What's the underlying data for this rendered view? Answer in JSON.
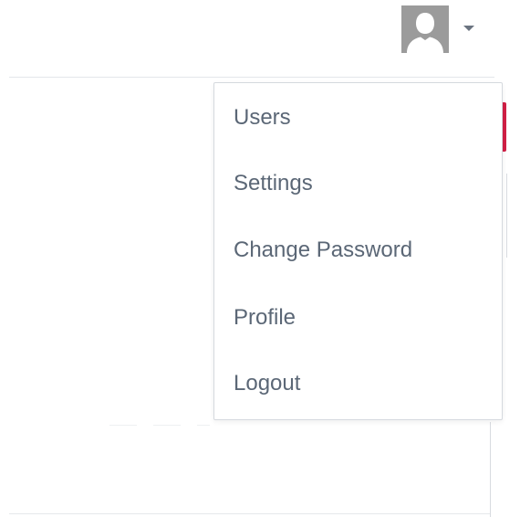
{
  "header": {
    "avatar_icon": "user-silhouette-icon",
    "caret_icon": "caret-down-icon"
  },
  "colors": {
    "menu_text": "#5b6776",
    "avatar_bg": "#9b9b9b",
    "accent_red": "#d01f45"
  },
  "user_menu": {
    "items": [
      {
        "label": "Users"
      },
      {
        "label": "Settings"
      },
      {
        "label": "Change Password"
      },
      {
        "label": "Profile"
      },
      {
        "label": "Logout"
      }
    ]
  }
}
